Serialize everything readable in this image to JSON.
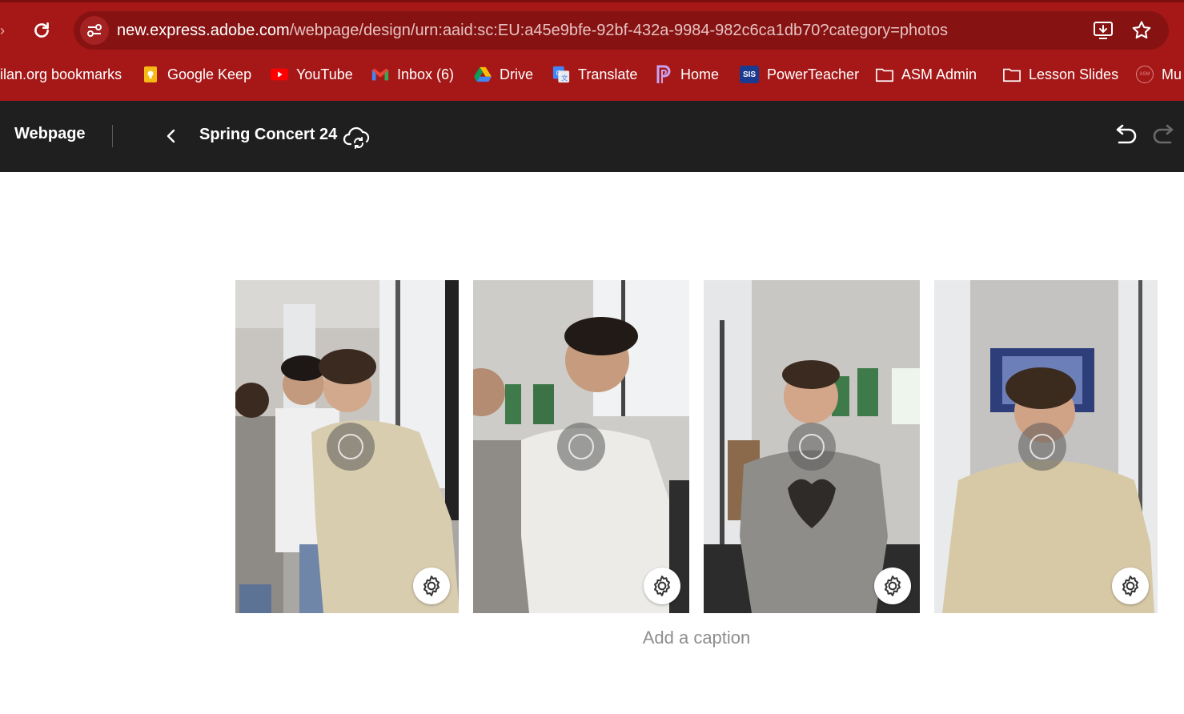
{
  "browser": {
    "url_host": "new.express.adobe.com",
    "url_path": "/webpage/design/urn:aaid:sc:EU:a45e9bfe-92bf-432a-9984-982c6ca1db70?category=photos",
    "bookmarks": [
      {
        "label": "ilan.org bookmarks",
        "icon": "none"
      },
      {
        "label": "Google Keep",
        "icon": "google-keep-icon"
      },
      {
        "label": "YouTube",
        "icon": "youtube-icon"
      },
      {
        "label": "Inbox (6)",
        "icon": "gmail-icon"
      },
      {
        "label": "Drive",
        "icon": "google-drive-icon"
      },
      {
        "label": "Translate",
        "icon": "google-translate-icon"
      },
      {
        "label": "Home",
        "icon": "pearson-icon"
      },
      {
        "label": "PowerTeacher",
        "icon": "sis-icon",
        "icon_text": "SIS"
      },
      {
        "label": "ASM Admin",
        "icon": "folder-icon"
      },
      {
        "label": "Lesson Slides",
        "icon": "folder-icon"
      },
      {
        "label": "Mu",
        "icon": "asm-icon",
        "icon_text": "ASM"
      }
    ]
  },
  "app": {
    "name": "Webpage",
    "document_title": "Spring Concert 24"
  },
  "gallery": {
    "photos": [
      {
        "alt": "photo-1"
      },
      {
        "alt": "photo-2"
      },
      {
        "alt": "photo-3"
      },
      {
        "alt": "photo-4"
      }
    ],
    "caption_placeholder": "Add a caption"
  },
  "colors": {
    "browser_frame": "#a61818",
    "omnibox": "#861212",
    "app_header": "#1f1f1f"
  }
}
